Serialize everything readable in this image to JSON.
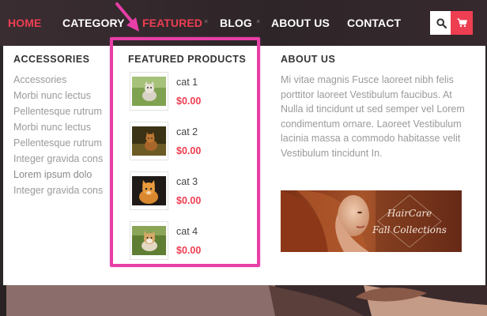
{
  "nav": {
    "items": [
      {
        "label": "HOME",
        "active": true
      },
      {
        "label": "CATEGORY"
      },
      {
        "label": "FEATURED",
        "active": true
      },
      {
        "label": "BLOG"
      },
      {
        "label": "ABOUT US"
      },
      {
        "label": "CONTACT"
      }
    ],
    "separator": "×",
    "search_icon": "search-icon",
    "cart_icon": "cart-icon"
  },
  "accessories": {
    "title": "ACCESSORIES",
    "items": [
      "Accessories",
      "Morbi nunc lectus",
      "Pellentesque rutrum",
      "Morbi nunc lectus",
      "Pellentesque rutrum",
      "Integer gravida cons",
      "Lorem ipsum dolo",
      "Integer gravida cons"
    ]
  },
  "featured": {
    "title": "FEATURED PRODUCTS",
    "products": [
      {
        "name": "cat 1",
        "price": "$0.00"
      },
      {
        "name": "cat 2",
        "price": "$0.00"
      },
      {
        "name": "cat 3",
        "price": "$0.00"
      },
      {
        "name": "cat 4",
        "price": "$0.00"
      }
    ]
  },
  "about": {
    "title": "ABOUT US",
    "text": "Mi vitae magnis Fusce laoreet nibh felis porttitor laoreet Vestibulum faucibus. At Nulla id tincidunt ut sed semper vel Lorem condimentum ornare. Laoreet Vestibulum lacinia massa a commodo habitasse velit Vestibulum tincidunt In.",
    "banner": {
      "line1": "HairCare",
      "line2": "Fall Collections"
    }
  },
  "colors": {
    "accent": "#ee3e52",
    "highlight": "#e83ea7",
    "nav_bg": "#2e2529"
  }
}
